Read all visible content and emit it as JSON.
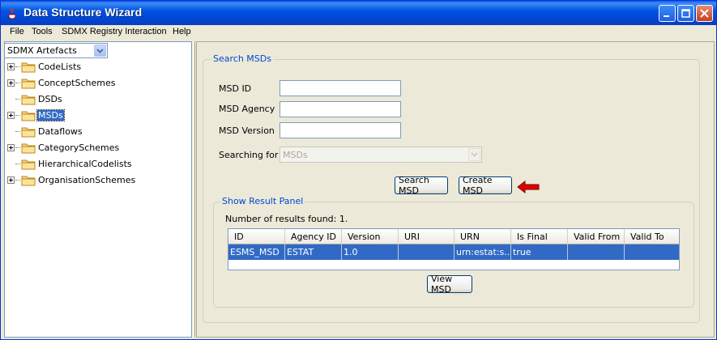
{
  "window": {
    "title": "Data Structure Wizard"
  },
  "menubar": {
    "items": [
      "File",
      "Tools",
      "SDMX Registry Interaction",
      "Help"
    ]
  },
  "left_panel": {
    "artefact_selector": {
      "value": "SDMX Artefacts"
    },
    "tree": [
      {
        "label": "CodeLists",
        "expandable": true,
        "selected": false
      },
      {
        "label": "ConceptSchemes",
        "expandable": true,
        "selected": false
      },
      {
        "label": "DSDs",
        "expandable": false,
        "selected": false
      },
      {
        "label": "MSDs",
        "expandable": true,
        "selected": true
      },
      {
        "label": "Dataflows",
        "expandable": false,
        "selected": false
      },
      {
        "label": "CategorySchemes",
        "expandable": true,
        "selected": false
      },
      {
        "label": "HierarchicalCodelists",
        "expandable": false,
        "selected": false
      },
      {
        "label": "OrganisationSchemes",
        "expandable": true,
        "selected": false
      }
    ]
  },
  "search_panel": {
    "title": "Search MSDs",
    "fields": {
      "msd_id": {
        "label": "MSD ID",
        "value": ""
      },
      "msd_agency": {
        "label": "MSD Agency",
        "value": ""
      },
      "msd_version": {
        "label": "MSD Version",
        "value": ""
      },
      "searching_for": {
        "label": "Searching for",
        "value": "MSDs"
      }
    },
    "search_button": "Search MSD",
    "create_button": "Create MSD"
  },
  "result_panel": {
    "title": "Show Result Panel",
    "results_count": "Number of results found: 1.",
    "columns": [
      "ID",
      "Agency ID",
      "Version",
      "URI",
      "URN",
      "Is Final",
      "Valid From",
      "Valid To"
    ],
    "rows": [
      [
        "ESMS_MSD",
        "ESTAT",
        "1.0",
        "",
        "urn:estat:s...",
        "true",
        "",
        ""
      ]
    ],
    "view_button": "View MSD"
  },
  "colors": {
    "selection": "#316ac5",
    "group_title": "#0046d5",
    "annotation_arrow": "#e00000"
  }
}
